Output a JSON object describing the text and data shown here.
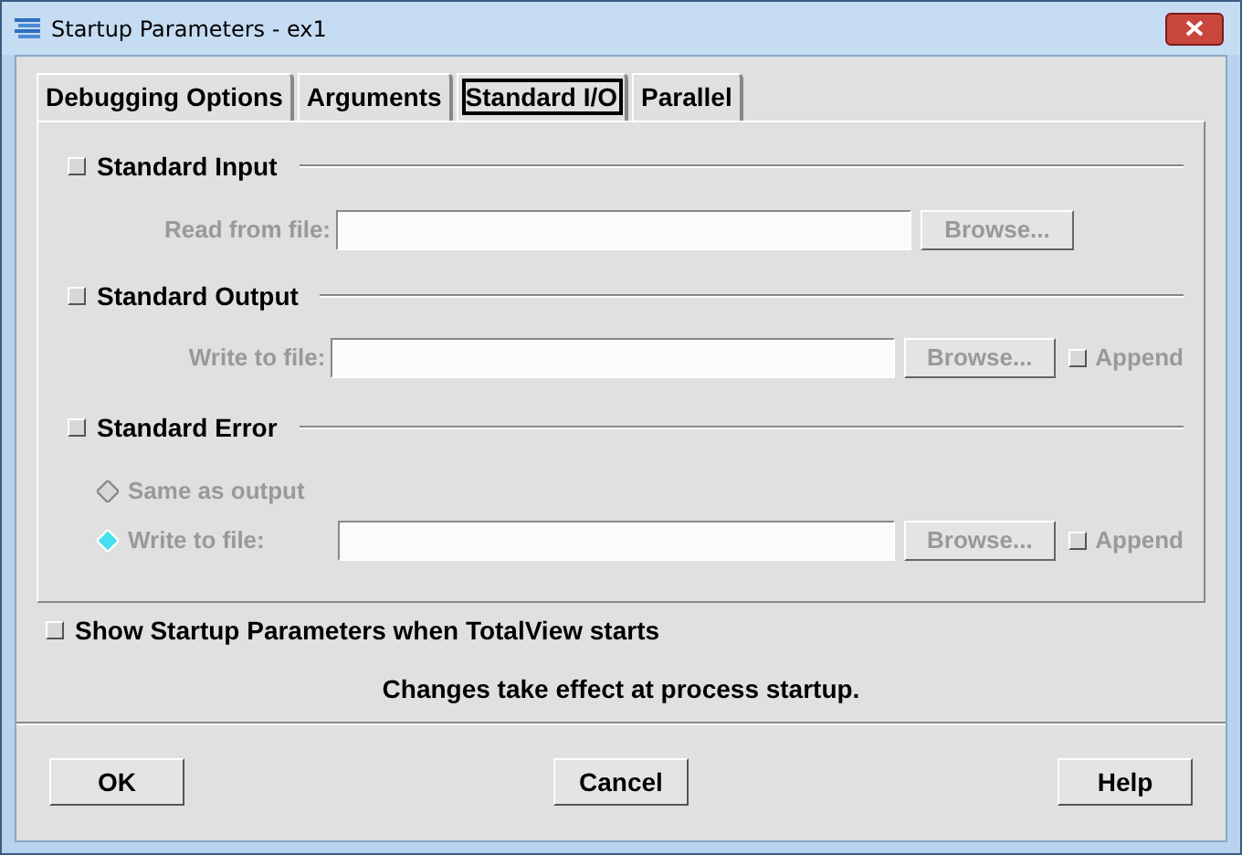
{
  "window": {
    "title": "Startup Parameters - ex1"
  },
  "tabs": [
    {
      "label": "Debugging Options",
      "selected": false
    },
    {
      "label": "Arguments",
      "selected": false
    },
    {
      "label": "Standard I/O",
      "selected": true
    },
    {
      "label": "Parallel",
      "selected": false
    }
  ],
  "sections": [
    {
      "label": "Standard Input",
      "checked": false,
      "rows": [
        {
          "kind": "file",
          "label": "Read from file:",
          "disabled": true,
          "browse": "Browse..."
        }
      ]
    },
    {
      "label": "Standard Output",
      "checked": false,
      "rows": [
        {
          "kind": "file",
          "label": "Write to file:",
          "disabled": true,
          "browse": "Browse...",
          "append": {
            "label": "Append",
            "checked": false
          }
        }
      ]
    },
    {
      "label": "Standard Error",
      "checked": false,
      "rows": [
        {
          "kind": "radio",
          "label": "Same as output",
          "disabled": true,
          "selected": false
        },
        {
          "kind": "radio-file",
          "label": "Write to file:",
          "disabled": true,
          "selected": true,
          "browse": "Browse...",
          "append": {
            "label": "Append",
            "checked": false
          }
        }
      ]
    }
  ],
  "show_startup": {
    "label": "Show Startup Parameters when TotalView starts",
    "checked": false
  },
  "note": "Changes take effect at process startup.",
  "buttons": [
    "OK",
    "Cancel",
    "Help"
  ]
}
